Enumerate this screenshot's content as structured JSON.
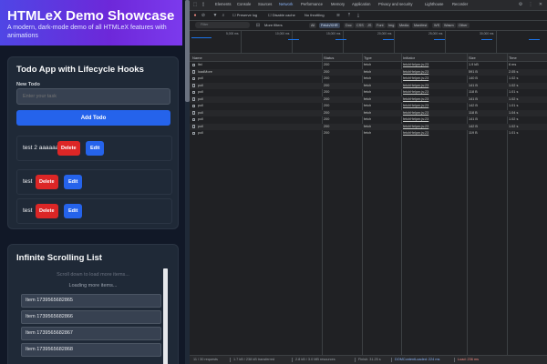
{
  "app": {
    "title": "HTMLeX Demo Showcase",
    "subtitle": "A modern, dark-mode demo of all HTMLeX features with animations",
    "todo": {
      "heading": "Todo App with Lifecycle Hooks",
      "field_label": "New Todo",
      "input_placeholder": "Enter your task",
      "add_label": "Add Todo",
      "delete_label": "Delete",
      "edit_label": "Edit",
      "items": [
        {
          "text": "test 2 aaaaaa"
        },
        {
          "text": "test"
        },
        {
          "text": "test"
        }
      ]
    },
    "scroll": {
      "heading": "Infinite Scrolling List",
      "hint": "Scroll down to load more items...",
      "loading": "Loading more items...",
      "items": [
        "Item 1739565682865",
        "Item 1739565682866",
        "Item 1739565682867",
        "Item 1739565682868"
      ]
    }
  },
  "devtools": {
    "tabs": [
      "Elements",
      "Console",
      "Sources",
      "Network",
      "Performance",
      "Memory",
      "Application",
      "Privacy and security",
      "Lighthouse",
      "Recorder"
    ],
    "active_tab": "Network",
    "toolbar": {
      "preserve_log": "Preserve log",
      "disable_cache": "Disable cache",
      "throttling": "No throttling"
    },
    "filter": {
      "placeholder": "Filter",
      "more_filters": "More filters",
      "types": [
        "All",
        "Fetch/XHR",
        "Doc",
        "CSS",
        "JS",
        "Font",
        "Img",
        "Media",
        "Manifest",
        "WS",
        "Wasm",
        "Other"
      ],
      "active_type": "Fetch/XHR"
    },
    "overview_ticks": [
      "5,000 ms",
      "10,000 ms",
      "15,000 ms",
      "20,000 ms",
      "25,000 ms",
      "30,000 ms"
    ],
    "columns": [
      "Name",
      "Status",
      "Type",
      "Initiator",
      "Size",
      "Time"
    ],
    "requests": [
      {
        "name": "list",
        "status": "200",
        "type": "fetch",
        "initiator": "fetchHelper.js:23",
        "size": "1.9 kB",
        "time": "6 ms"
      },
      {
        "name": "loadMore",
        "status": "200",
        "type": "fetch",
        "initiator": "fetchHelper.js:23",
        "size": "591 B",
        "time": "2.05 s"
      },
      {
        "name": "poll",
        "status": "200",
        "type": "fetch",
        "initiator": "fetchHelper.js:23",
        "size": "140 B",
        "time": "1.02 s"
      },
      {
        "name": "poll",
        "status": "200",
        "type": "fetch",
        "initiator": "fetchHelper.js:23",
        "size": "141 B",
        "time": "1.02 s"
      },
      {
        "name": "poll",
        "status": "200",
        "type": "fetch",
        "initiator": "fetchHelper.js:23",
        "size": "118 B",
        "time": "1.01 s"
      },
      {
        "name": "poll",
        "status": "200",
        "type": "fetch",
        "initiator": "fetchHelper.js:23",
        "size": "141 B",
        "time": "1.02 s"
      },
      {
        "name": "poll",
        "status": "200",
        "type": "fetch",
        "initiator": "fetchHelper.js:23",
        "size": "142 B",
        "time": "1.01 s"
      },
      {
        "name": "poll",
        "status": "200",
        "type": "fetch",
        "initiator": "fetchHelper.js:23",
        "size": "118 B",
        "time": "1.04 s"
      },
      {
        "name": "poll",
        "status": "200",
        "type": "fetch",
        "initiator": "fetchHelper.js:23",
        "size": "141 B",
        "time": "1.02 s"
      },
      {
        "name": "poll",
        "status": "200",
        "type": "fetch",
        "initiator": "fetchHelper.js:23",
        "size": "142 B",
        "time": "1.02 s"
      },
      {
        "name": "poll",
        "status": "200",
        "type": "fetch",
        "initiator": "fetchHelper.js:23",
        "size": "119 B",
        "time": "1.01 s"
      }
    ],
    "status_bar": [
      "11 / 30 requests",
      "1.7 kB / 238 kB transferred",
      "2.8 kB / 3.0 MB resources",
      "Finish: 31.25 s",
      "DOMContentLoaded: 224 ms",
      "Load: 236 ms"
    ]
  },
  "colors": {
    "hero_start": "#4f46e5",
    "hero_end": "#7c3aed",
    "primary_button": "#2563eb",
    "danger_button": "#dc2626",
    "card_bg": "#1f2937",
    "page_bg": "#111827",
    "devtools_bg": "#202124"
  }
}
